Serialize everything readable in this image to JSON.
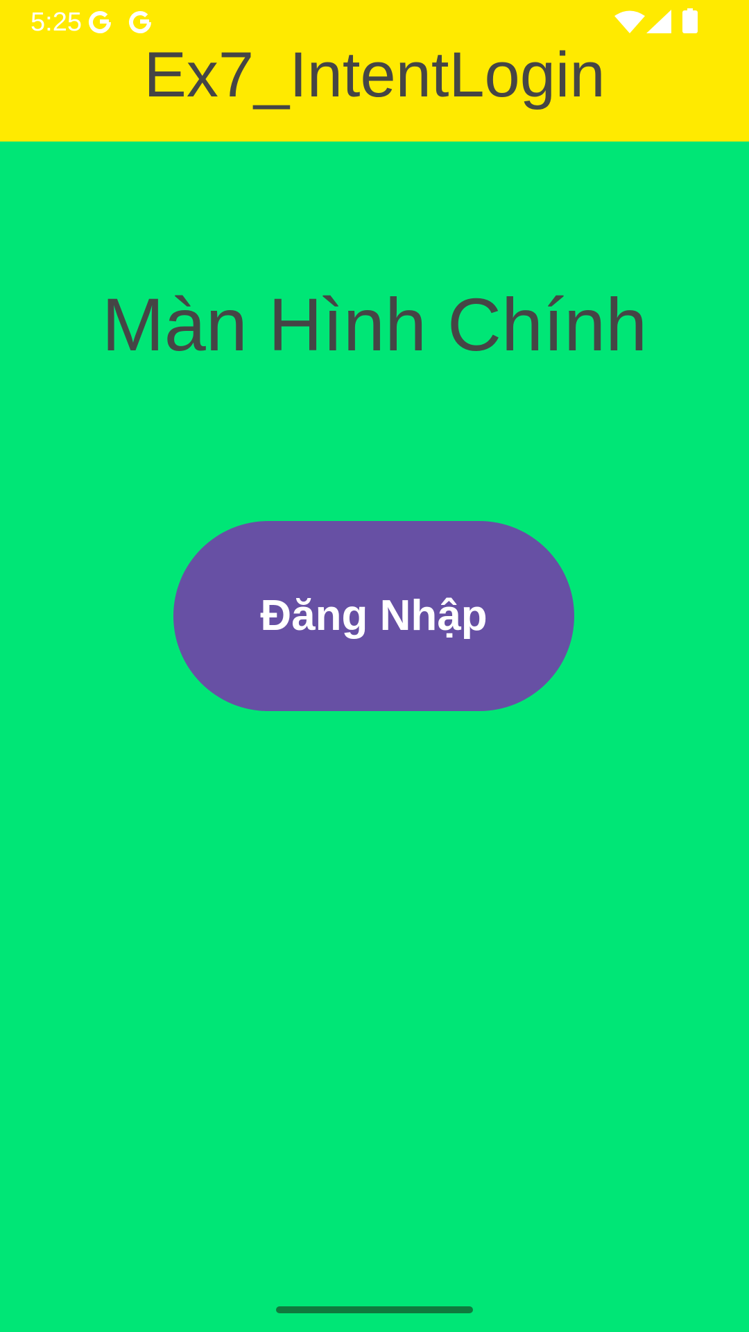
{
  "status_bar": {
    "time": "5:25",
    "icons": [
      "google-icon",
      "google-icon",
      "wifi-icon",
      "cell-signal-icon",
      "battery-icon"
    ]
  },
  "app_bar": {
    "title": "Ex7_IntentLogin"
  },
  "main": {
    "title": "Màn Hình Chính",
    "login_button_label": "Đăng Nhập"
  },
  "colors": {
    "header_background": "#FFEA00",
    "page_background": "#00E676",
    "button_background": "#6750A4",
    "title_text": "#454545",
    "button_text": "#FFFFFF"
  }
}
